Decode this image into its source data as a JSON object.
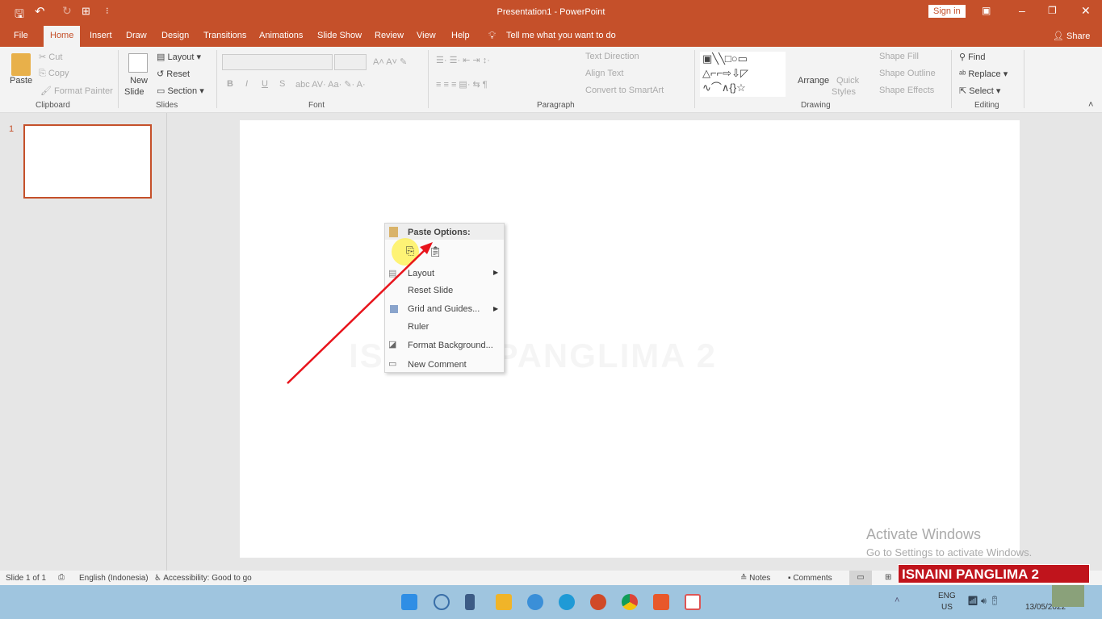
{
  "title": "Presentation1  -  PowerPoint",
  "signin": "Sign in",
  "tabs": [
    "File",
    "Home",
    "Insert",
    "Draw",
    "Design",
    "Transitions",
    "Animations",
    "Slide Show",
    "Review",
    "View",
    "Help"
  ],
  "tell_me": "Tell me what you want to do",
  "share": "Share",
  "clipboard": {
    "paste": "Paste",
    "cut": "Cut",
    "copy": "Copy",
    "format_painter": "Format Painter",
    "label": "Clipboard"
  },
  "slides": {
    "new_slide_1": "New",
    "new_slide_2": "Slide",
    "layout": "Layout",
    "reset": "Reset",
    "section": "Section",
    "label": "Slides"
  },
  "font": {
    "label": "Font",
    "bold": "B",
    "italic": "I",
    "underline": "U",
    "shadow": "S"
  },
  "paragraph": {
    "label": "Paragraph",
    "text_direction": "Text Direction",
    "align_text": "Align Text",
    "convert": "Convert to SmartArt"
  },
  "drawing": {
    "label": "Drawing",
    "arrange": "Arrange",
    "quick_styles_1": "Quick",
    "quick_styles_2": "Styles",
    "shape_fill": "Shape Fill",
    "shape_outline": "Shape Outline",
    "shape_effects": "Shape Effects"
  },
  "editing": {
    "label": "Editing",
    "find": "Find",
    "replace": "Replace",
    "select": "Select"
  },
  "thumb_number": "1",
  "watermark": "ISNAINI PANGLIMA 2",
  "menu": {
    "paste_options": "Paste Options:",
    "items": [
      "Layout",
      "Reset Slide",
      "Grid and Guides...",
      "Ruler",
      "Format Background...",
      "New Comment"
    ]
  },
  "activate": {
    "title": "Activate Windows",
    "sub": "Go to Settings to activate Windows."
  },
  "status": {
    "slide": "Slide 1 of 1",
    "language": "English (Indonesia)",
    "accessibility": "Accessibility: Good to go",
    "notes": "Notes",
    "comments": "Comments"
  },
  "channel_banner": "ISNAINI PANGLIMA 2",
  "taskbar": {
    "lang1": "ENG",
    "lang2": "US",
    "date": "13/05/2022"
  },
  "colors": {
    "accent": "#c5502a",
    "taskbar": "#9fc5df",
    "arrow": "#e8141c"
  }
}
